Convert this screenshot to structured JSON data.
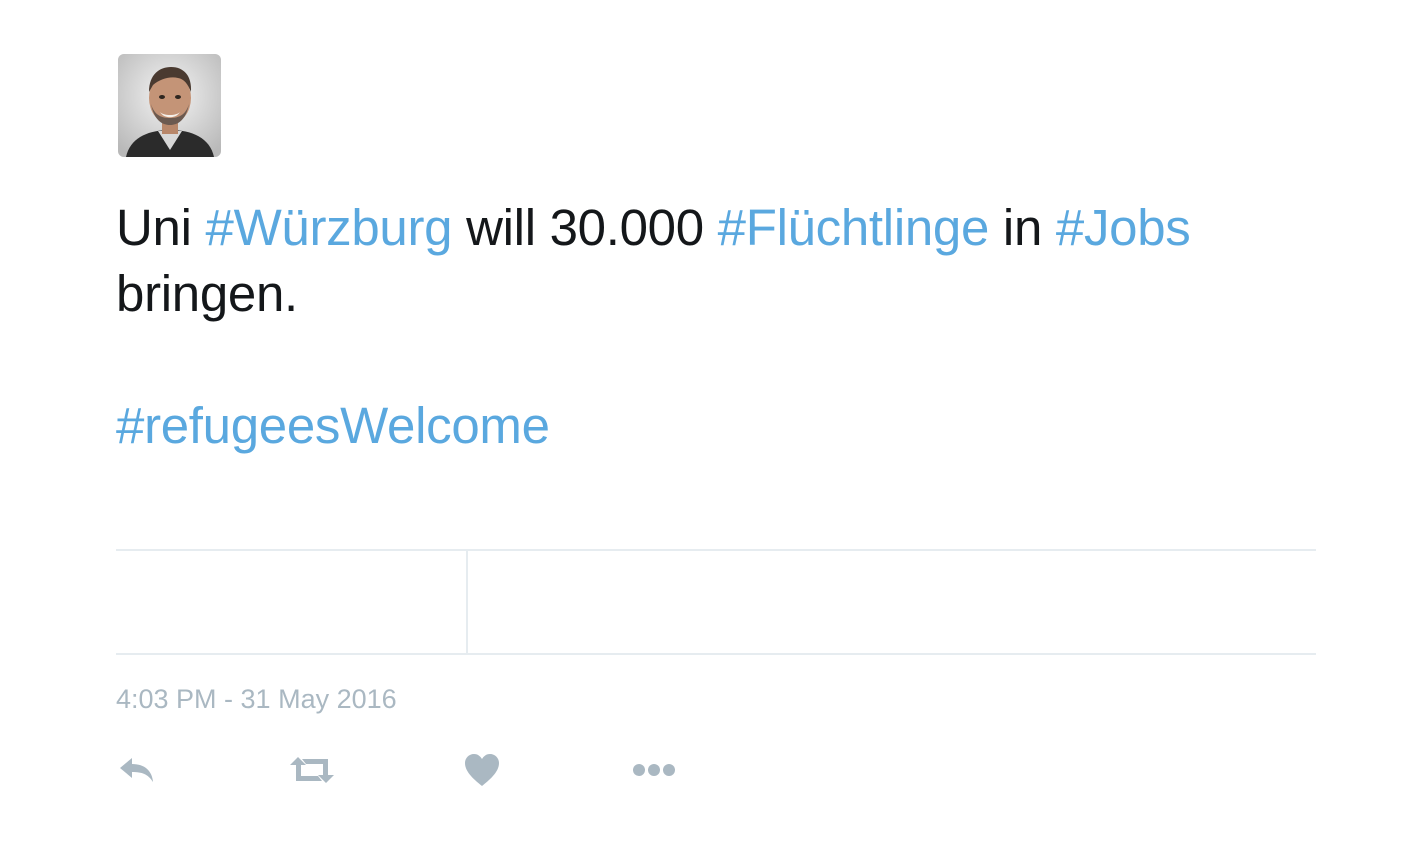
{
  "tweet": {
    "line1": [
      {
        "text": "Uni ",
        "hashtag": false
      },
      {
        "text": "#Würzburg",
        "hashtag": true
      },
      {
        "text": " will 30.000 ",
        "hashtag": false
      },
      {
        "text": "#Flüchtlinge",
        "hashtag": true
      },
      {
        "text": " in ",
        "hashtag": false
      },
      {
        "text": "#Jobs",
        "hashtag": true
      },
      {
        "text": " bringen.",
        "hashtag": false
      }
    ],
    "line2_hashtag": "#refugeesWelcome",
    "timestamp": "4:03 PM - 31 May 2016"
  },
  "colors": {
    "hashtag": "#5aa8df",
    "meta_text": "#aab8c2",
    "icon": "#aab8c2",
    "divider": "#e6ecf0"
  },
  "actions": {
    "icons": [
      "reply-icon",
      "retweet-icon",
      "like-icon",
      "more-icon"
    ]
  }
}
